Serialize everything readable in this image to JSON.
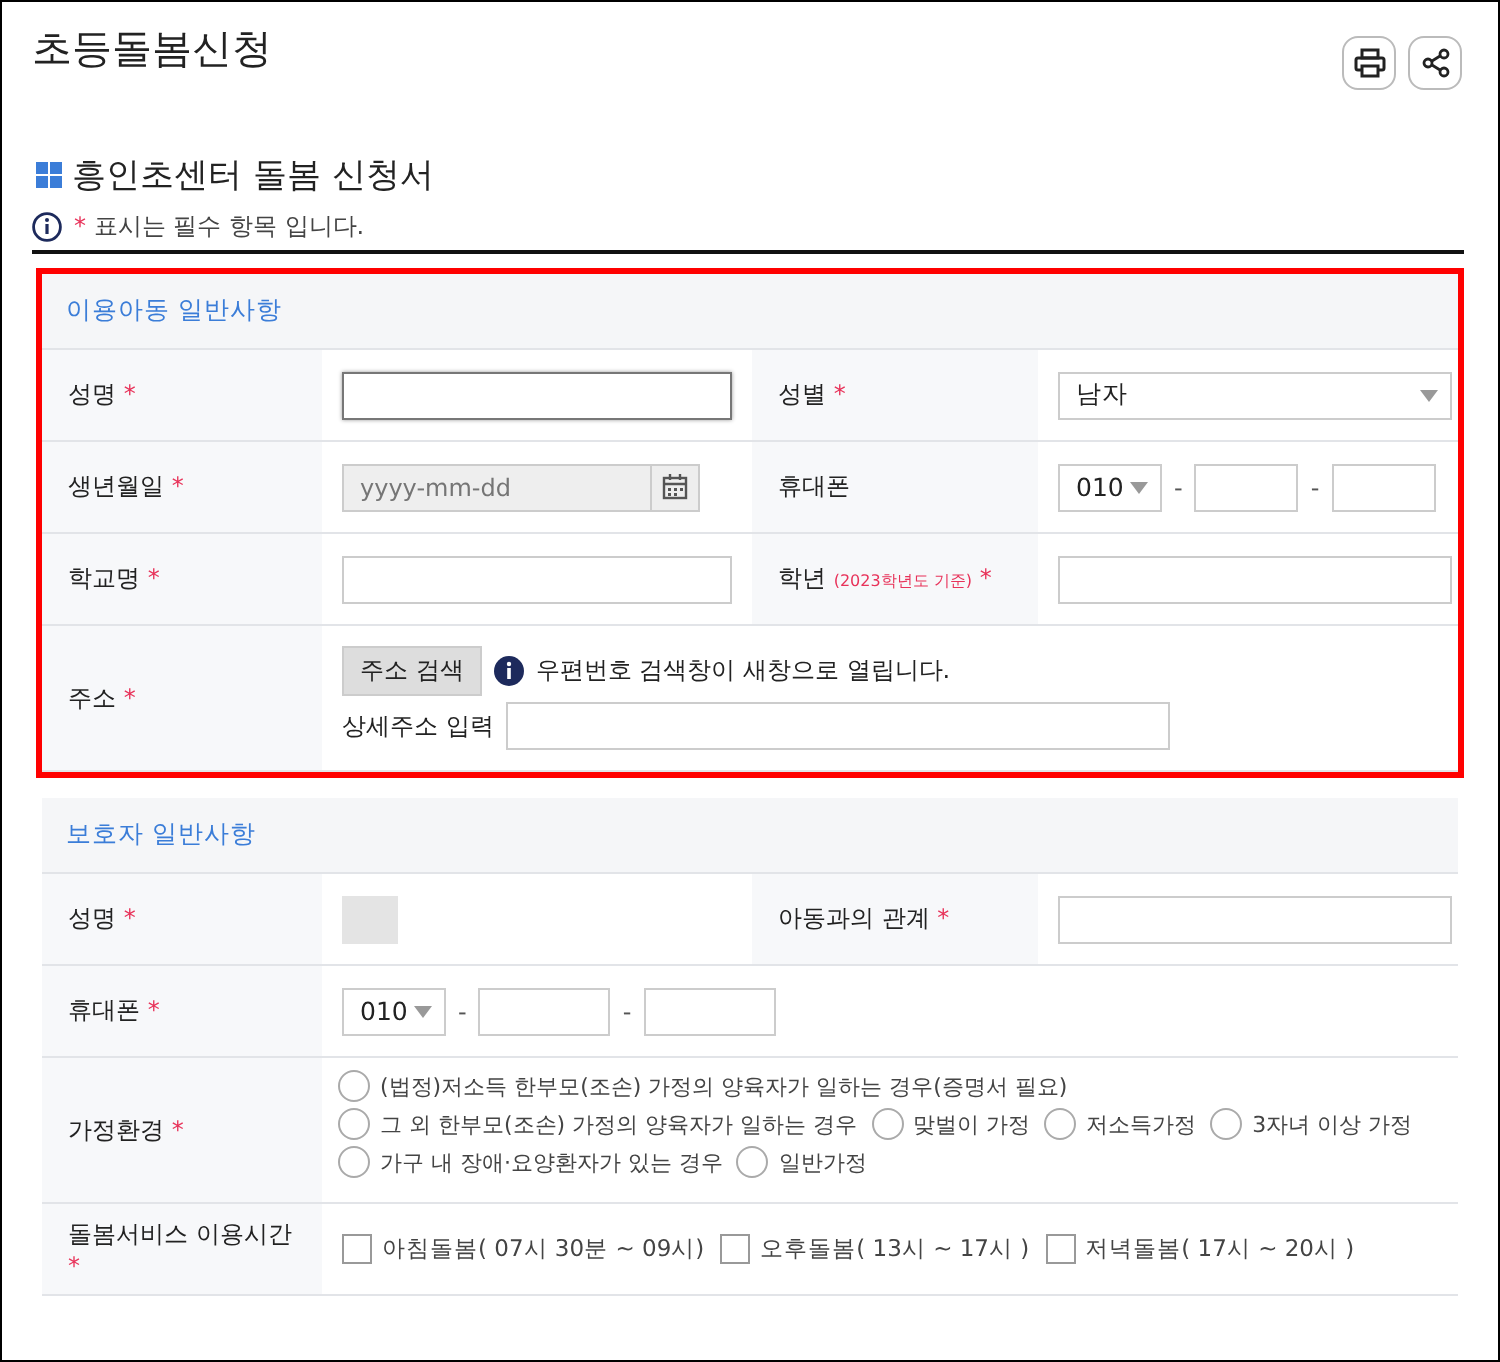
{
  "page_title": "초등돌봄신청",
  "tools": [
    {
      "kind": "print"
    },
    {
      "kind": "share"
    }
  ],
  "form_title": "흥인초센터 돌봄 신청서",
  "required_note": {
    "mark": "*",
    "text": "표시는 필수 항목 입니다."
  },
  "sections": [
    {
      "title": "이용아동 일반사항",
      "highlighted": true,
      "rows": [
        {
          "fields": [
            {
              "label": "성명",
              "required": true,
              "control": {
                "kind": "text",
                "focused": true
              }
            },
            {
              "label": "성별",
              "required": true,
              "control": {
                "kind": "select",
                "value": "남자"
              }
            }
          ]
        },
        {
          "fields": [
            {
              "label": "생년월일",
              "required": true,
              "control": {
                "kind": "date",
                "placeholder": "yyyy-mm-dd",
                "disabled": true
              }
            },
            {
              "label": "휴대폰",
              "required": false,
              "control": {
                "kind": "phone",
                "prefix": "010",
                "separators": [
                  "-",
                  "-"
                ]
              }
            }
          ]
        },
        {
          "fields": [
            {
              "label": "학교명",
              "required": true,
              "control": {
                "kind": "text",
                "focused": false
              }
            },
            {
              "label": "학년",
              "note": "(2023학년도 기준)",
              "required": true,
              "control": {
                "kind": "text",
                "focused": false
              }
            }
          ]
        },
        {
          "fields": [
            {
              "label": "주소",
              "required": true,
              "control": {
                "kind": "address",
                "button": "주소 검색",
                "info": "우편번호 검색창이 새창으로 열립니다.",
                "detail_label": "상세주소 입력"
              }
            }
          ]
        }
      ]
    },
    {
      "title": "보호자 일반사항",
      "highlighted": false,
      "rows": [
        {
          "fields": [
            {
              "label": "성명",
              "required": true,
              "control": {
                "kind": "redacted"
              }
            },
            {
              "label": "아동과의 관계",
              "required": true,
              "control": {
                "kind": "text",
                "focused": false
              }
            }
          ]
        },
        {
          "fields": [
            {
              "label": "휴대폰",
              "required": true,
              "control": {
                "kind": "phone",
                "prefix": "010",
                "separators": [
                  "-",
                  "-"
                ]
              }
            }
          ]
        },
        {
          "fields": [
            {
              "label": "가정환경",
              "required": true,
              "control": {
                "kind": "radio",
                "lines": [
                  [
                    {
                      "label": "(법정)저소득 한부모(조손) 가정의 양육자가 일하는 경우(증명서 필요)",
                      "selected": false
                    }
                  ],
                  [
                    {
                      "label": "그 외 한부모(조손) 가정의 양육자가 일하는 경우",
                      "selected": false
                    },
                    {
                      "label": "맞벌이 가정",
                      "selected": false
                    },
                    {
                      "label": "저소득가정",
                      "selected": false
                    },
                    {
                      "label": "3자녀 이상 가정",
                      "selected": false
                    }
                  ],
                  [
                    {
                      "label": "가구 내 장애·요양환자가 있는 경우",
                      "selected": false
                    },
                    {
                      "label": "일반가정",
                      "selected": false
                    }
                  ]
                ]
              }
            }
          ]
        },
        {
          "fields": [
            {
              "label": "돌봄서비스 이용시간",
              "required": true,
              "control": {
                "kind": "checkbox",
                "options": [
                  {
                    "label": "아침돌봄( 07시 30분 ~ 09시)",
                    "checked": false
                  },
                  {
                    "label": "오후돌봄( 13시 ~ 17시 )",
                    "checked": false
                  },
                  {
                    "label": "저녁돌봄( 17시 ~ 20시 )",
                    "checked": false
                  }
                ]
              }
            }
          ]
        }
      ]
    }
  ]
}
